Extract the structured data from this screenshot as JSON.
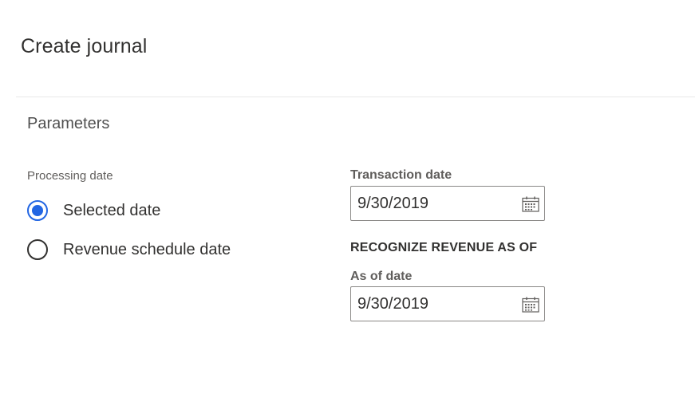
{
  "dialog": {
    "title": "Create journal"
  },
  "parameters": {
    "section_title": "Parameters",
    "processing_date": {
      "label": "Processing date",
      "options": [
        {
          "label": "Selected date",
          "checked": true
        },
        {
          "label": "Revenue schedule date",
          "checked": false
        }
      ]
    },
    "transaction_date": {
      "label": "Transaction date",
      "value": "9/30/2019",
      "icon": "calendar-icon"
    },
    "recognize_heading": "RECOGNIZE REVENUE AS OF",
    "as_of_date": {
      "label": "As of date",
      "value": "9/30/2019",
      "icon": "calendar-icon"
    }
  },
  "colors": {
    "accent": "#2266e3",
    "text": "#323130",
    "label": "#605e5c",
    "border": "#8a8886"
  }
}
